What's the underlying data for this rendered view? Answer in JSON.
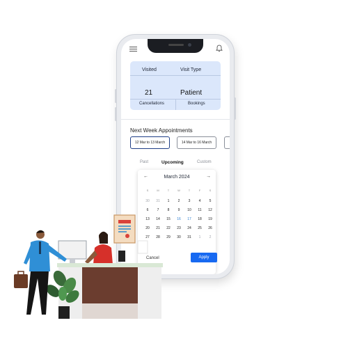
{
  "stats": {
    "visited_label": "Visited",
    "visit_type_label": "Visit Type",
    "visited_value": "21",
    "visit_type_value": "Patient",
    "cancellations_label": "Cancellations",
    "bookings_label": "Bookings"
  },
  "appointments": {
    "title": "Next Week Appointments",
    "ranges": [
      "12 Mar to 13 March",
      "14 Mar to 16 March"
    ]
  },
  "tabs": [
    "Past",
    "Upcoming",
    "Custom"
  ],
  "calendar": {
    "month": "March 2024",
    "prev": "←",
    "next": "→",
    "weekdays": [
      "S",
      "M",
      "T",
      "W",
      "T",
      "F",
      "S"
    ],
    "rows": [
      [
        "30",
        "31",
        "1",
        "2",
        "3",
        "4",
        "5"
      ],
      [
        "6",
        "7",
        "8",
        "9",
        "10",
        "11",
        "12"
      ],
      [
        "13",
        "14",
        "15",
        "16",
        "17",
        "18",
        "19"
      ],
      [
        "20",
        "21",
        "22",
        "23",
        "24",
        "25",
        "26"
      ],
      [
        "27",
        "28",
        "29",
        "30",
        "31",
        "1",
        "2"
      ]
    ],
    "muted_leading": 2,
    "muted_trailing": 2,
    "highlighted": [
      "16",
      "17"
    ],
    "cancel_label": "Cancel",
    "apply_label": "Apply"
  },
  "colors": {
    "primary": "#1769f1",
    "stats_bg": "#dbe7fb",
    "highlight": "#2f7fd1"
  }
}
